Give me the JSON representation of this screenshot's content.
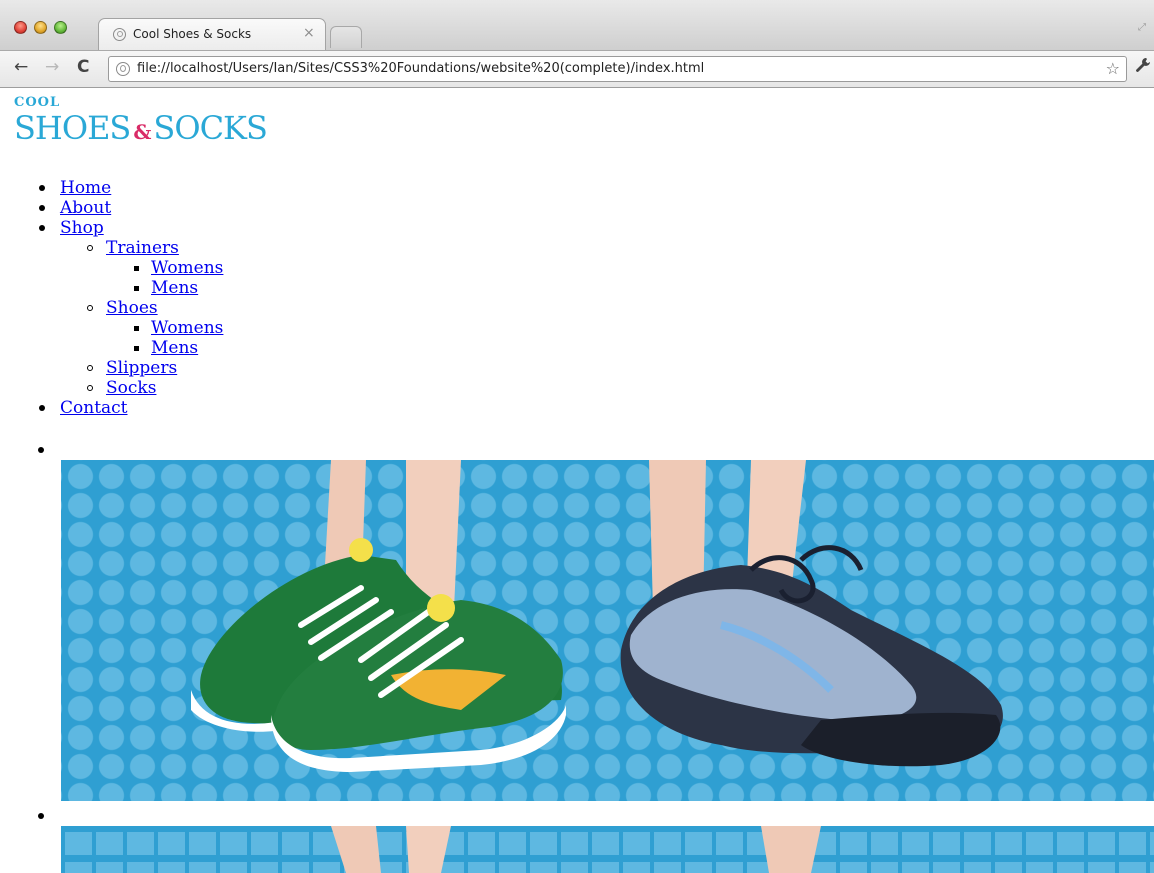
{
  "browser": {
    "tab_title": "Cool Shoes & Socks",
    "tab_close": "×",
    "url": "file://localhost/Users/Ian/Sites/CSS3%20Foundations/website%20(complete)/index.html",
    "icons": {
      "back": "←",
      "forward": "→",
      "reload": "C",
      "star": "☆",
      "wrench": "🔧"
    }
  },
  "logo": {
    "small": "COOL",
    "part1": "SHOES",
    "amp": "&",
    "part2": "SOCKS",
    "colors": {
      "primary": "#2aa8d6",
      "accent": "#d92b67"
    }
  },
  "nav": {
    "home": "Home",
    "about": "About",
    "shop": "Shop",
    "trainers": "Trainers",
    "trainers_womens": "Womens",
    "trainers_mens": "Mens",
    "shoes": "Shoes",
    "shoes_womens": "Womens",
    "shoes_mens": "Mens",
    "slippers": "Slippers",
    "socks": "Socks",
    "contact": "Contact"
  },
  "slides": {
    "banner1": {
      "description_colors": {
        "background": "#2f9fd2",
        "dots": "#5eb8e1"
      }
    },
    "banner2": {
      "description_colors": {
        "background": "#2f9fd2",
        "squares": "#5eb8e1"
      }
    }
  }
}
